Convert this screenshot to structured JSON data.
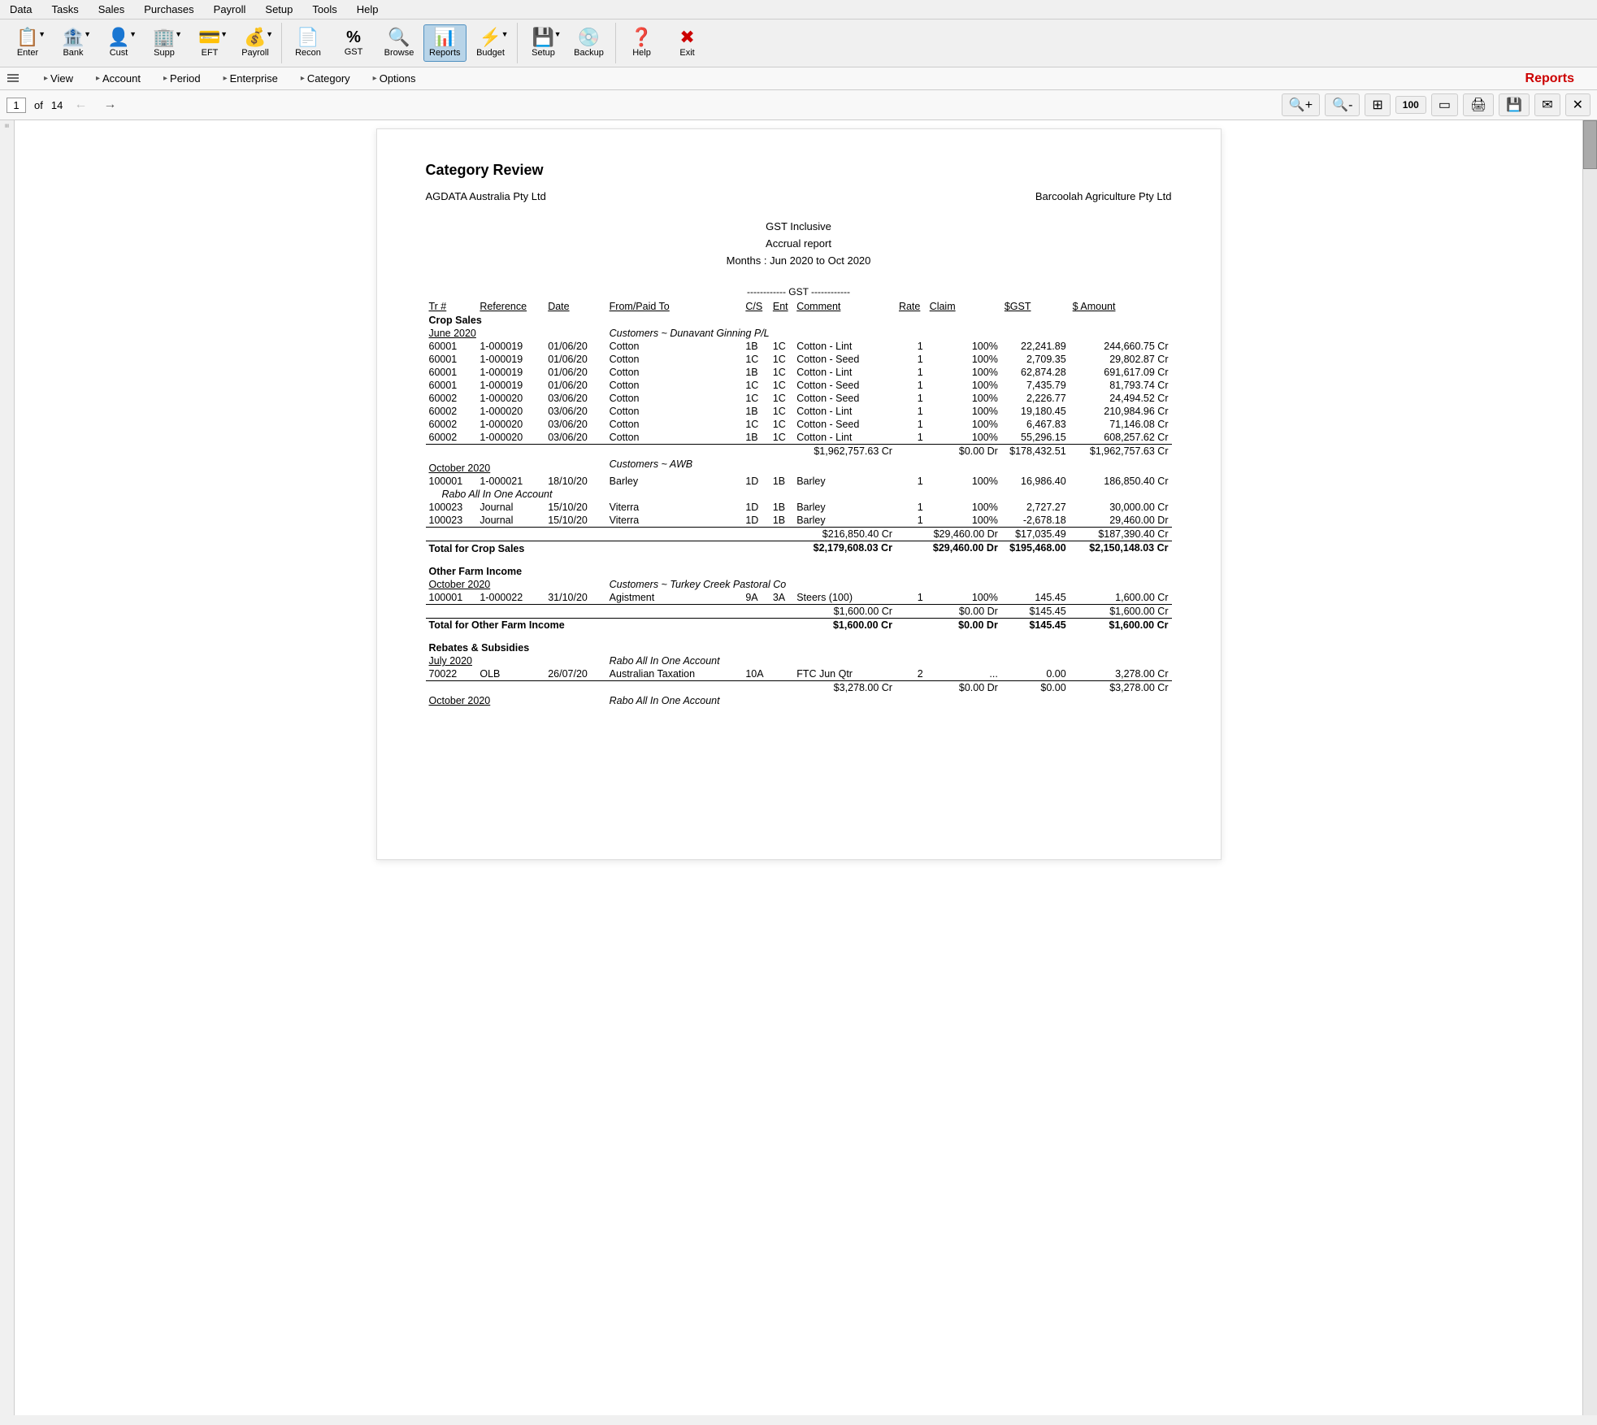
{
  "menu": {
    "items": [
      "Data",
      "Tasks",
      "Sales",
      "Purchases",
      "Payroll",
      "Setup",
      "Tools",
      "Help"
    ]
  },
  "toolbar": {
    "buttons": [
      {
        "id": "enter",
        "label": "Enter",
        "icon": "📋",
        "has_dropdown": true
      },
      {
        "id": "bank",
        "label": "Bank",
        "icon": "🏦",
        "has_dropdown": true
      },
      {
        "id": "cust",
        "label": "Cust",
        "icon": "👤",
        "has_dropdown": true
      },
      {
        "id": "supp",
        "label": "Supp",
        "icon": "🏢",
        "has_dropdown": true
      },
      {
        "id": "eft",
        "label": "EFT",
        "icon": "💳",
        "has_dropdown": true
      },
      {
        "id": "payroll",
        "label": "Payroll",
        "icon": "💰",
        "has_dropdown": true
      },
      {
        "id": "recon",
        "label": "Recon",
        "icon": "📄"
      },
      {
        "id": "gst",
        "label": "GST",
        "icon": "%"
      },
      {
        "id": "browse",
        "label": "Browse",
        "icon": "🔍"
      },
      {
        "id": "reports",
        "label": "Reports",
        "icon": "📊",
        "active": true
      },
      {
        "id": "budget",
        "label": "Budget",
        "icon": "⚡",
        "has_dropdown": true
      },
      {
        "id": "setup",
        "label": "Setup",
        "icon": "💾",
        "has_dropdown": true
      },
      {
        "id": "backup",
        "label": "Backup",
        "icon": "💿"
      },
      {
        "id": "help",
        "label": "Help",
        "icon": "❓"
      },
      {
        "id": "exit",
        "label": "Exit",
        "icon": "✖"
      }
    ]
  },
  "secondary_toolbar": {
    "nav_items": [
      {
        "id": "view",
        "label": "View"
      },
      {
        "id": "account",
        "label": "Account"
      },
      {
        "id": "period",
        "label": "Period"
      },
      {
        "id": "enterprise",
        "label": "Enterprise"
      },
      {
        "id": "category",
        "label": "Category"
      },
      {
        "id": "options",
        "label": "Options"
      }
    ],
    "reports_title": "Reports"
  },
  "page_controls": {
    "current_page": "1",
    "total_pages": "14",
    "controls": [
      "zoom-in",
      "zoom-out",
      "fit-page",
      "page-width",
      "fit-one",
      "print",
      "save",
      "email",
      "close"
    ]
  },
  "report": {
    "title": "Category Review",
    "company_left": "AGDATA Australia Pty Ltd",
    "company_right": "Barcoolah Agriculture Pty Ltd",
    "subtitle_line1": "GST Inclusive",
    "subtitle_line2": "Accrual report",
    "subtitle_line3": "Months : Jun 2020 to Oct 2020",
    "gst_header": "------------ GST ------------",
    "columns": {
      "tr": "Tr #",
      "reference": "Reference",
      "date": "Date",
      "from_paid_to": "From/Paid To",
      "cs": "C/S",
      "ent": "Ent",
      "comment": "Comment",
      "rate": "Rate",
      "claim": "Claim",
      "sgst": "$GST",
      "amount": "$ Amount"
    },
    "sections": [
      {
        "name": "Crop Sales",
        "periods": [
          {
            "period": "June 2020",
            "customer": "Customers ~ Dunavant Ginning P/L",
            "rows": [
              {
                "tr": "60001",
                "ref": "1-000019",
                "date": "01/06/20",
                "from": "Cotton",
                "cs": "1B",
                "ent": "1C",
                "comment": "Cotton - Lint",
                "rate": "1",
                "claim": "100%",
                "sgst": "22,241.89",
                "amount": "244,660.75 Cr"
              },
              {
                "tr": "60001",
                "ref": "1-000019",
                "date": "01/06/20",
                "from": "Cotton",
                "cs": "1C",
                "ent": "1C",
                "comment": "Cotton - Seed",
                "rate": "1",
                "claim": "100%",
                "sgst": "2,709.35",
                "amount": "29,802.87 Cr"
              },
              {
                "tr": "60001",
                "ref": "1-000019",
                "date": "01/06/20",
                "from": "Cotton",
                "cs": "1B",
                "ent": "1C",
                "comment": "Cotton - Lint",
                "rate": "1",
                "claim": "100%",
                "sgst": "62,874.28",
                "amount": "691,617.09 Cr"
              },
              {
                "tr": "60001",
                "ref": "1-000019",
                "date": "01/06/20",
                "from": "Cotton",
                "cs": "1C",
                "ent": "1C",
                "comment": "Cotton - Seed",
                "rate": "1",
                "claim": "100%",
                "sgst": "7,435.79",
                "amount": "81,793.74 Cr"
              },
              {
                "tr": "60002",
                "ref": "1-000020",
                "date": "03/06/20",
                "from": "Cotton",
                "cs": "1C",
                "ent": "1C",
                "comment": "Cotton - Seed",
                "rate": "1",
                "claim": "100%",
                "sgst": "2,226.77",
                "amount": "24,494.52 Cr"
              },
              {
                "tr": "60002",
                "ref": "1-000020",
                "date": "03/06/20",
                "from": "Cotton",
                "cs": "1B",
                "ent": "1C",
                "comment": "Cotton - Lint",
                "rate": "1",
                "claim": "100%",
                "sgst": "19,180.45",
                "amount": "210,984.96 Cr"
              },
              {
                "tr": "60002",
                "ref": "1-000020",
                "date": "03/06/20",
                "from": "Cotton",
                "cs": "1C",
                "ent": "1C",
                "comment": "Cotton - Seed",
                "rate": "1",
                "claim": "100%",
                "sgst": "6,467.83",
                "amount": "71,146.08 Cr"
              },
              {
                "tr": "60002",
                "ref": "1-000020",
                "date": "03/06/20",
                "from": "Cotton",
                "cs": "1B",
                "ent": "1C",
                "comment": "Cotton - Lint",
                "rate": "1",
                "claim": "100%",
                "sgst": "55,296.15",
                "amount": "608,257.62 Cr"
              }
            ],
            "subtotal": {
              "amount_cr": "$1,962,757.63 Cr",
              "claim": "$0.00 Dr",
              "sgst": "$178,432.51",
              "amount": "$1,962,757.63 Cr"
            }
          },
          {
            "period": "October 2020",
            "customer": "Customers ~ AWB",
            "rows": [
              {
                "tr": "100001",
                "ref": "1-000021",
                "date": "18/10/20",
                "from": "Barley",
                "cs": "1D",
                "ent": "1B",
                "comment": "Barley",
                "rate": "1",
                "claim": "100%",
                "sgst": "16,986.40",
                "amount": "186,850.40 Cr"
              }
            ],
            "sub_customer": "Rabo All In One Account",
            "sub_rows": [
              {
                "tr": "100023",
                "ref": "Journal",
                "date": "15/10/20",
                "from": "Viterra",
                "cs": "1D",
                "ent": "1B",
                "comment": "Barley",
                "rate": "1",
                "claim": "100%",
                "sgst": "2,727.27",
                "amount": "30,000.00 Cr"
              },
              {
                "tr": "100023",
                "ref": "Journal",
                "date": "15/10/20",
                "from": "Viterra",
                "cs": "1D",
                "ent": "1B",
                "comment": "Barley",
                "rate": "1",
                "claim": "100%",
                "sgst": "-2,678.18",
                "amount": "29,460.00 Dr"
              }
            ],
            "subtotal": {
              "amount_cr": "$216,850.40 Cr",
              "claim": "$29,460.00 Dr",
              "sgst": "$17,035.49",
              "amount": "$187,390.40 Cr"
            }
          }
        ],
        "total": {
          "label": "Total for Crop Sales",
          "amount_cr": "$2,179,608.03 Cr",
          "claim": "$29,460.00 Dr",
          "sgst": "$195,468.00",
          "amount": "$2,150,148.03 Cr"
        }
      },
      {
        "name": "Other Farm Income",
        "periods": [
          {
            "period": "October 2020",
            "customer": "Customers ~ Turkey Creek Pastoral Co",
            "rows": [
              {
                "tr": "100001",
                "ref": "1-000022",
                "date": "31/10/20",
                "from": "Agistment",
                "cs": "9A",
                "ent": "3A",
                "comment": "Steers (100)",
                "rate": "1",
                "claim": "100%",
                "sgst": "145.45",
                "amount": "1,600.00 Cr"
              }
            ],
            "subtotal": {
              "amount_cr": "$1,600.00 Cr",
              "claim": "$0.00 Dr",
              "sgst": "$145.45",
              "amount": "$1,600.00 Cr"
            }
          }
        ],
        "total": {
          "label": "Total for Other Farm Income",
          "amount_cr": "$1,600.00 Cr",
          "claim": "$0.00 Dr",
          "sgst": "$145.45",
          "amount": "$1,600.00 Cr"
        }
      },
      {
        "name": "Rebates & Subsidies",
        "periods": [
          {
            "period": "July 2020",
            "customer": "Rabo All In One Account",
            "rows": [
              {
                "tr": "70022",
                "ref": "OLB",
                "date": "26/07/20",
                "from": "Australian Taxation",
                "cs": "10A",
                "ent": "",
                "comment": "FTC Jun Qtr",
                "rate": "2",
                "claim": "...",
                "sgst": "0.00",
                "amount": "3,278.00 Cr"
              }
            ],
            "subtotal": {
              "amount_cr": "$3,278.00 Cr",
              "claim": "$0.00 Dr",
              "sgst": "$0.00",
              "amount": "$3,278.00 Cr"
            }
          },
          {
            "period": "October 2020",
            "customer": "Rabo All In One Account",
            "rows": []
          }
        ]
      }
    ]
  }
}
